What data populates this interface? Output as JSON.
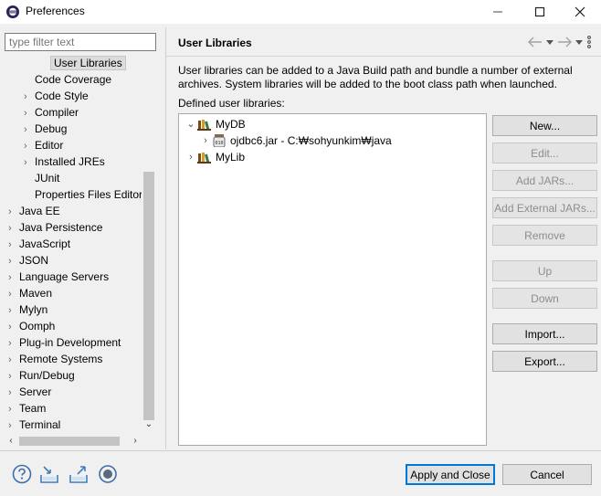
{
  "window": {
    "title": "Preferences"
  },
  "filter": {
    "placeholder": "type filter text"
  },
  "tree": [
    {
      "label": "User Libraries",
      "indent": 2,
      "chevron": false,
      "selected": true
    },
    {
      "label": "Code Coverage",
      "indent": 1,
      "chevron": false
    },
    {
      "label": "Code Style",
      "indent": 1,
      "chevron": true
    },
    {
      "label": "Compiler",
      "indent": 1,
      "chevron": true
    },
    {
      "label": "Debug",
      "indent": 1,
      "chevron": true
    },
    {
      "label": "Editor",
      "indent": 1,
      "chevron": true
    },
    {
      "label": "Installed JREs",
      "indent": 1,
      "chevron": true
    },
    {
      "label": "JUnit",
      "indent": 1,
      "chevron": false
    },
    {
      "label": "Properties Files Editor",
      "indent": 1,
      "chevron": false
    },
    {
      "label": "Java EE",
      "indent": 0,
      "chevron": true
    },
    {
      "label": "Java Persistence",
      "indent": 0,
      "chevron": true
    },
    {
      "label": "JavaScript",
      "indent": 0,
      "chevron": true
    },
    {
      "label": "JSON",
      "indent": 0,
      "chevron": true
    },
    {
      "label": "Language Servers",
      "indent": 0,
      "chevron": true
    },
    {
      "label": "Maven",
      "indent": 0,
      "chevron": true
    },
    {
      "label": "Mylyn",
      "indent": 0,
      "chevron": true
    },
    {
      "label": "Oomph",
      "indent": 0,
      "chevron": true
    },
    {
      "label": "Plug-in Development",
      "indent": 0,
      "chevron": true
    },
    {
      "label": "Remote Systems",
      "indent": 0,
      "chevron": true
    },
    {
      "label": "Run/Debug",
      "indent": 0,
      "chevron": true
    },
    {
      "label": "Server",
      "indent": 0,
      "chevron": true
    },
    {
      "label": "Team",
      "indent": 0,
      "chevron": true
    },
    {
      "label": "Terminal",
      "indent": 0,
      "chevron": true
    }
  ],
  "page": {
    "title": "User Libraries",
    "description": "User libraries can be added to a Java Build path and bundle a number of external archives. System libraries will be added to the boot class path when launched.",
    "defined_label": "Defined user libraries:"
  },
  "libraries": [
    {
      "label": "MyDB",
      "level": 0,
      "expanded": true,
      "kind": "library"
    },
    {
      "label": "ojdbc6.jar - C:₩sohyunkim₩java",
      "level": 1,
      "expanded": false,
      "kind": "jar"
    },
    {
      "label": "MyLib",
      "level": 0,
      "expanded": false,
      "kind": "library"
    }
  ],
  "buttons": {
    "new": "New...",
    "edit": "Edit...",
    "add_jars": "Add JARs...",
    "add_external_jars": "Add External JARs...",
    "remove": "Remove",
    "up": "Up",
    "down": "Down",
    "import": "Import...",
    "export": "Export..."
  },
  "dialog": {
    "apply_close": "Apply and Close",
    "cancel": "Cancel"
  }
}
